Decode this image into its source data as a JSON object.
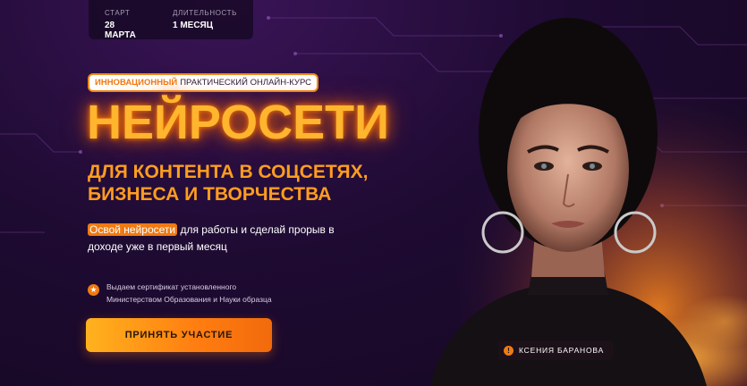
{
  "info": {
    "start_label": "СТАРТ",
    "start_value": "28 МАРТА",
    "duration_label": "ДЛИТЕЛЬНОСТЬ",
    "duration_value": "1 МЕСЯЦ"
  },
  "tagline": {
    "accent": "ИННОВАЦИОННЫЙ",
    "rest": "ПРАКТИЧЕСКИЙ ОНЛАЙН-КУРС"
  },
  "headline": "НЕЙРОСЕТИ",
  "subhead": {
    "line1": "ДЛЯ КОНТЕНТА В СОЦСЕТЯХ,",
    "line2": "БИЗНЕСА И ТВОРЧЕСТВА"
  },
  "lead": {
    "highlight": "Освой нейросети",
    "rest": " для работы и сделай прорыв в доходе уже в первый месяц"
  },
  "certificate": {
    "icon": "star-icon",
    "line1": "Выдаем сертификат установленного",
    "line2": "Министерством Образования и Науки образца"
  },
  "cta_label": "ПРИНЯТЬ УЧАСТИЕ",
  "speaker": {
    "initial": "!",
    "name": "КСЕНИЯ БАРАНОВА"
  },
  "colors": {
    "accent": "#f07a12",
    "headline": "#ffb52e",
    "background": "#1f0b33"
  }
}
